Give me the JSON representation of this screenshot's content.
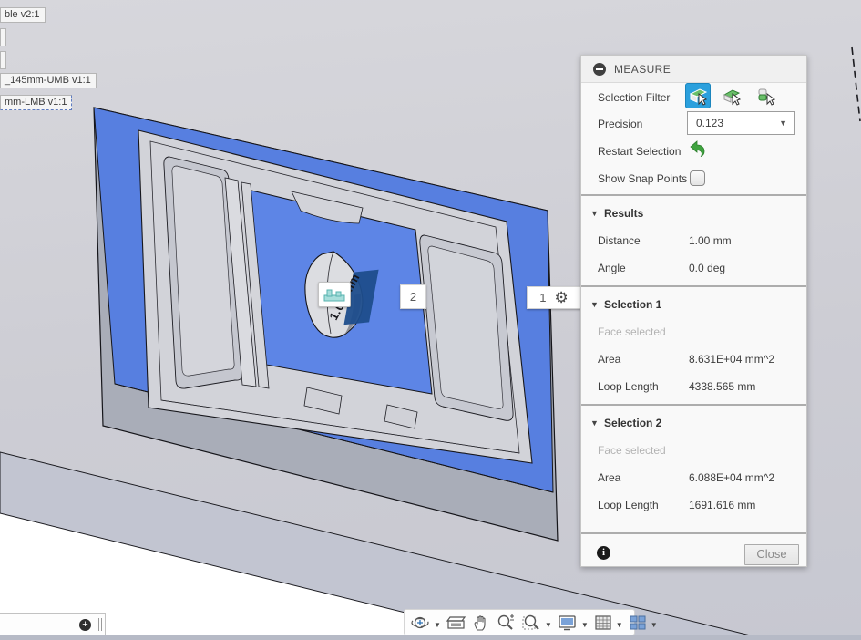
{
  "app": "Fusion 360 viewport with MEASURE dialog",
  "colors": {
    "selection_blue": "#577fe0",
    "inner_selection_blue": "#5d85e6",
    "filter_active_blue": "#2ba0dd",
    "flag_navy": "#1d4d8c",
    "restart_green": "#3fa33f",
    "panel_bg": "#f9f9f9",
    "viewport_gray": "#cdcdd4"
  },
  "browser_labels": {
    "label1": "ble v2:1",
    "label2": "_145mm-UMB v1:1",
    "label3": "mm-LMB v1:1"
  },
  "viewport": {
    "measurement_value": "1.00 mm",
    "marker1_label": "1",
    "marker2_label": "2",
    "icons": [
      "measure-badge-icon",
      "selection-gear-icon"
    ]
  },
  "panel": {
    "title": "MEASURE",
    "selection_filter_label": "Selection Filter",
    "filter_icons": [
      "face-filter-icon",
      "edge-filter-icon",
      "body-filter-icon"
    ],
    "precision_label": "Precision",
    "precision_value": "0.123",
    "restart_label": "Restart Selection",
    "snap_label": "Show Snap Points",
    "snap_checked": false,
    "sections": [
      {
        "header": "Results",
        "rows": [
          {
            "label": "Distance",
            "value": "1.00 mm"
          },
          {
            "label": "Angle",
            "value": "0.0 deg"
          }
        ]
      },
      {
        "header": "Selection 1",
        "status": "Face selected",
        "rows": [
          {
            "label": "Area",
            "value": "8.631E+04 mm^2"
          },
          {
            "label": "Loop Length",
            "value": "4338.565 mm"
          }
        ]
      },
      {
        "header": "Selection 2",
        "status": "Face selected",
        "rows": [
          {
            "label": "Area",
            "value": "6.088E+04 mm^2"
          },
          {
            "label": "Loop Length",
            "value": "1691.616 mm"
          }
        ]
      }
    ],
    "close_label": "Close"
  },
  "nav_toolbar": {
    "icons": [
      "orbit",
      "look-at",
      "pan",
      "zoom",
      "zoom-window",
      "display-settings",
      "grid-snap",
      "viewports"
    ]
  }
}
